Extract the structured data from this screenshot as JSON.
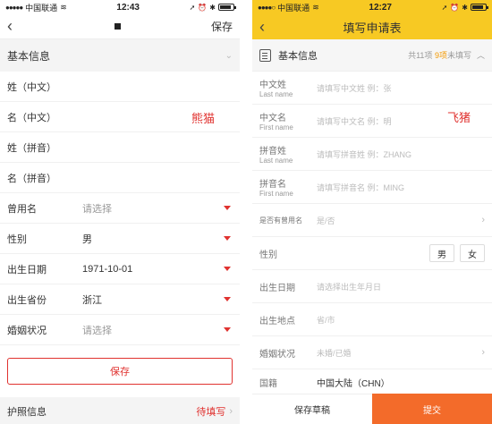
{
  "left": {
    "status": {
      "carrier": "中国联通",
      "time": "12:43"
    },
    "nav": {
      "save_label": "保存"
    },
    "section": {
      "title": "基本信息"
    },
    "rows": [
      {
        "label": "姓（中文）",
        "value": ""
      },
      {
        "label": "名（中文）",
        "value": ""
      },
      {
        "label": "姓（拼音）",
        "value": ""
      },
      {
        "label": "名（拼音）",
        "value": ""
      },
      {
        "label": "曾用名",
        "value": "请选择"
      },
      {
        "label": "性别",
        "value": "男"
      },
      {
        "label": "出生日期",
        "value": "1971-10-01"
      },
      {
        "label": "出生省份",
        "value": "浙江"
      },
      {
        "label": "婚姻状况",
        "value": "请选择"
      }
    ],
    "annotation": "熊猫",
    "save_button": "保存",
    "passport": {
      "label": "护照信息",
      "status": "待填写"
    }
  },
  "right": {
    "status": {
      "carrier": "中国联通",
      "time": "12:27"
    },
    "nav": {
      "title": "填写申请表"
    },
    "section": {
      "title": "基本信息",
      "count_prefix": "共11项",
      "count_num": "9项",
      "count_suffix": "未填写"
    },
    "rows": [
      {
        "cn": "中文姓",
        "en": "Last name",
        "placeholder": "请填写中文姓 例：张"
      },
      {
        "cn": "中文名",
        "en": "First name",
        "placeholder": "请填写中文名 例：明"
      },
      {
        "cn": "拼音姓",
        "en": "Last name",
        "placeholder": "请填写拼音姓 例：ZHANG"
      },
      {
        "cn": "拼音名",
        "en": "First name",
        "placeholder": "请填写拼音名 例：MING"
      }
    ],
    "former_name": {
      "label": "是否有曾用名",
      "placeholder": "是/否"
    },
    "gender": {
      "label": "性别",
      "male": "男",
      "female": "女"
    },
    "birth_date": {
      "label": "出生日期",
      "placeholder": "请选择出生年月日"
    },
    "birth_place": {
      "label": "出生地点",
      "placeholder": "省/市"
    },
    "marital": {
      "label": "婚姻状况",
      "placeholder": "未婚/已婚"
    },
    "nationality": {
      "label": "国籍",
      "value": "中国大陆（CHN）"
    },
    "annotation": "飞猪",
    "draft_label": "保存草稿",
    "submit_label": "提交"
  }
}
